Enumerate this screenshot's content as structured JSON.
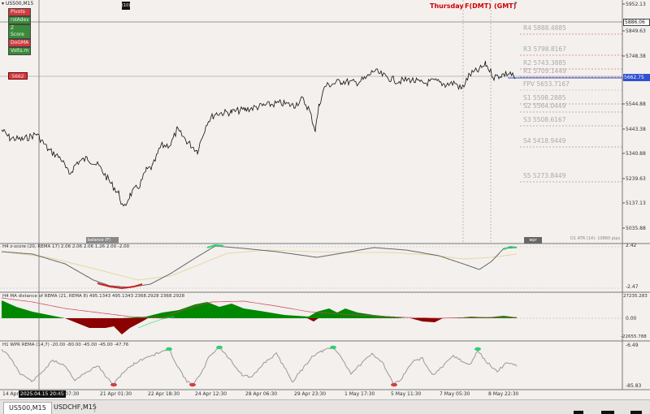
{
  "symbol_header": "US500,M15",
  "top_labels": {
    "day": "Thursday",
    "fdmt": "F(DMT)",
    "gmt": "(GMT)"
  },
  "menu_box": "(10)",
  "legend_buttons": [
    {
      "label": "Pivots",
      "bg": "#d33b3b",
      "fg": "#f0f0f0"
    },
    {
      "label": "rolAdev",
      "bg": "#3b8a3b",
      "fg": "#e8f8e8"
    },
    {
      "label": "Z Score",
      "bg": "#3b8a3b",
      "fg": "#e8f8e8"
    },
    {
      "label": "DoGMA",
      "bg": "#d33b3b",
      "fg": "#f0f0f0"
    },
    {
      "label": "Volts.m",
      "bg": "#3b8a3b",
      "fg": "#e8f8e8"
    }
  ],
  "price_box_left": "5662",
  "pivots": [
    {
      "name": "R4",
      "value": "5888.4885"
    },
    {
      "name": "R3",
      "value": "5798.8167"
    },
    {
      "name": "R2",
      "value": "5743.3885"
    },
    {
      "name": "R1",
      "value": "5709.1449"
    },
    {
      "name": "FPV",
      "value": "5653.7167"
    },
    {
      "name": "S1",
      "value": "5598.2885"
    },
    {
      "name": "S2",
      "value": "5564.0449"
    },
    {
      "name": "S3",
      "value": "5508.6167"
    },
    {
      "name": "S4",
      "value": "5418.9449"
    },
    {
      "name": "S5",
      "value": "5273.8449"
    }
  ],
  "price_axis": {
    "ticks": [
      "5952.13",
      "5849.63",
      "5748.38",
      "5647.13",
      "5544.88",
      "5443.38",
      "5340.88",
      "5239.63",
      "5137.13",
      "5035.88"
    ],
    "crosshair_price": "5886.06",
    "current_price": "5662.75"
  },
  "main_chart": {
    "bottom_left_label": "balance (F)",
    "bottom_right_label": "wpr",
    "atr_text": "D1 ATR (14): 10860 pips"
  },
  "zscore_panel": {
    "title": "H4 z-score (20, REMA 17) 2.06 2.06 2.06 1.26 2.00 -2.00",
    "ticks": [
      "2.42",
      "-2.47"
    ]
  },
  "ma_panel": {
    "title": "H4 MA distance of REMA (21, REMA 8) 495.1343 495.1343 2368.2928 2368.2928",
    "ticks": [
      "27235.283",
      "0.00",
      "-22655.788"
    ]
  },
  "wpr_panel": {
    "title": "H1 WPR  REMA  (14,7) -20.00 -80.00 -45.00 -45.00 -47.76",
    "ticks": [
      "-6.49",
      "-85.83"
    ]
  },
  "time_axis": {
    "first_label": "14 Apr",
    "cursor_label": "2025.04.15 20:45",
    "labels": [
      "pr 07:30",
      "21 Apr 01:30",
      "22 Apr 18:30",
      "24 Apr 12:30",
      "28 Apr 06:30",
      "29 Apr 23:30",
      "1 May 17:30",
      "5 May 11:30",
      "7 May 05:30",
      "8 May 22:30"
    ]
  },
  "tabs": [
    "US500,M15",
    "USDCHF,M15"
  ],
  "colors": {
    "pivot_red": "#d04040",
    "current_price_blue": "#3050d0",
    "ma_green": "#008800",
    "ma_red": "#8b0000",
    "zscore_green": "#30d070"
  }
}
